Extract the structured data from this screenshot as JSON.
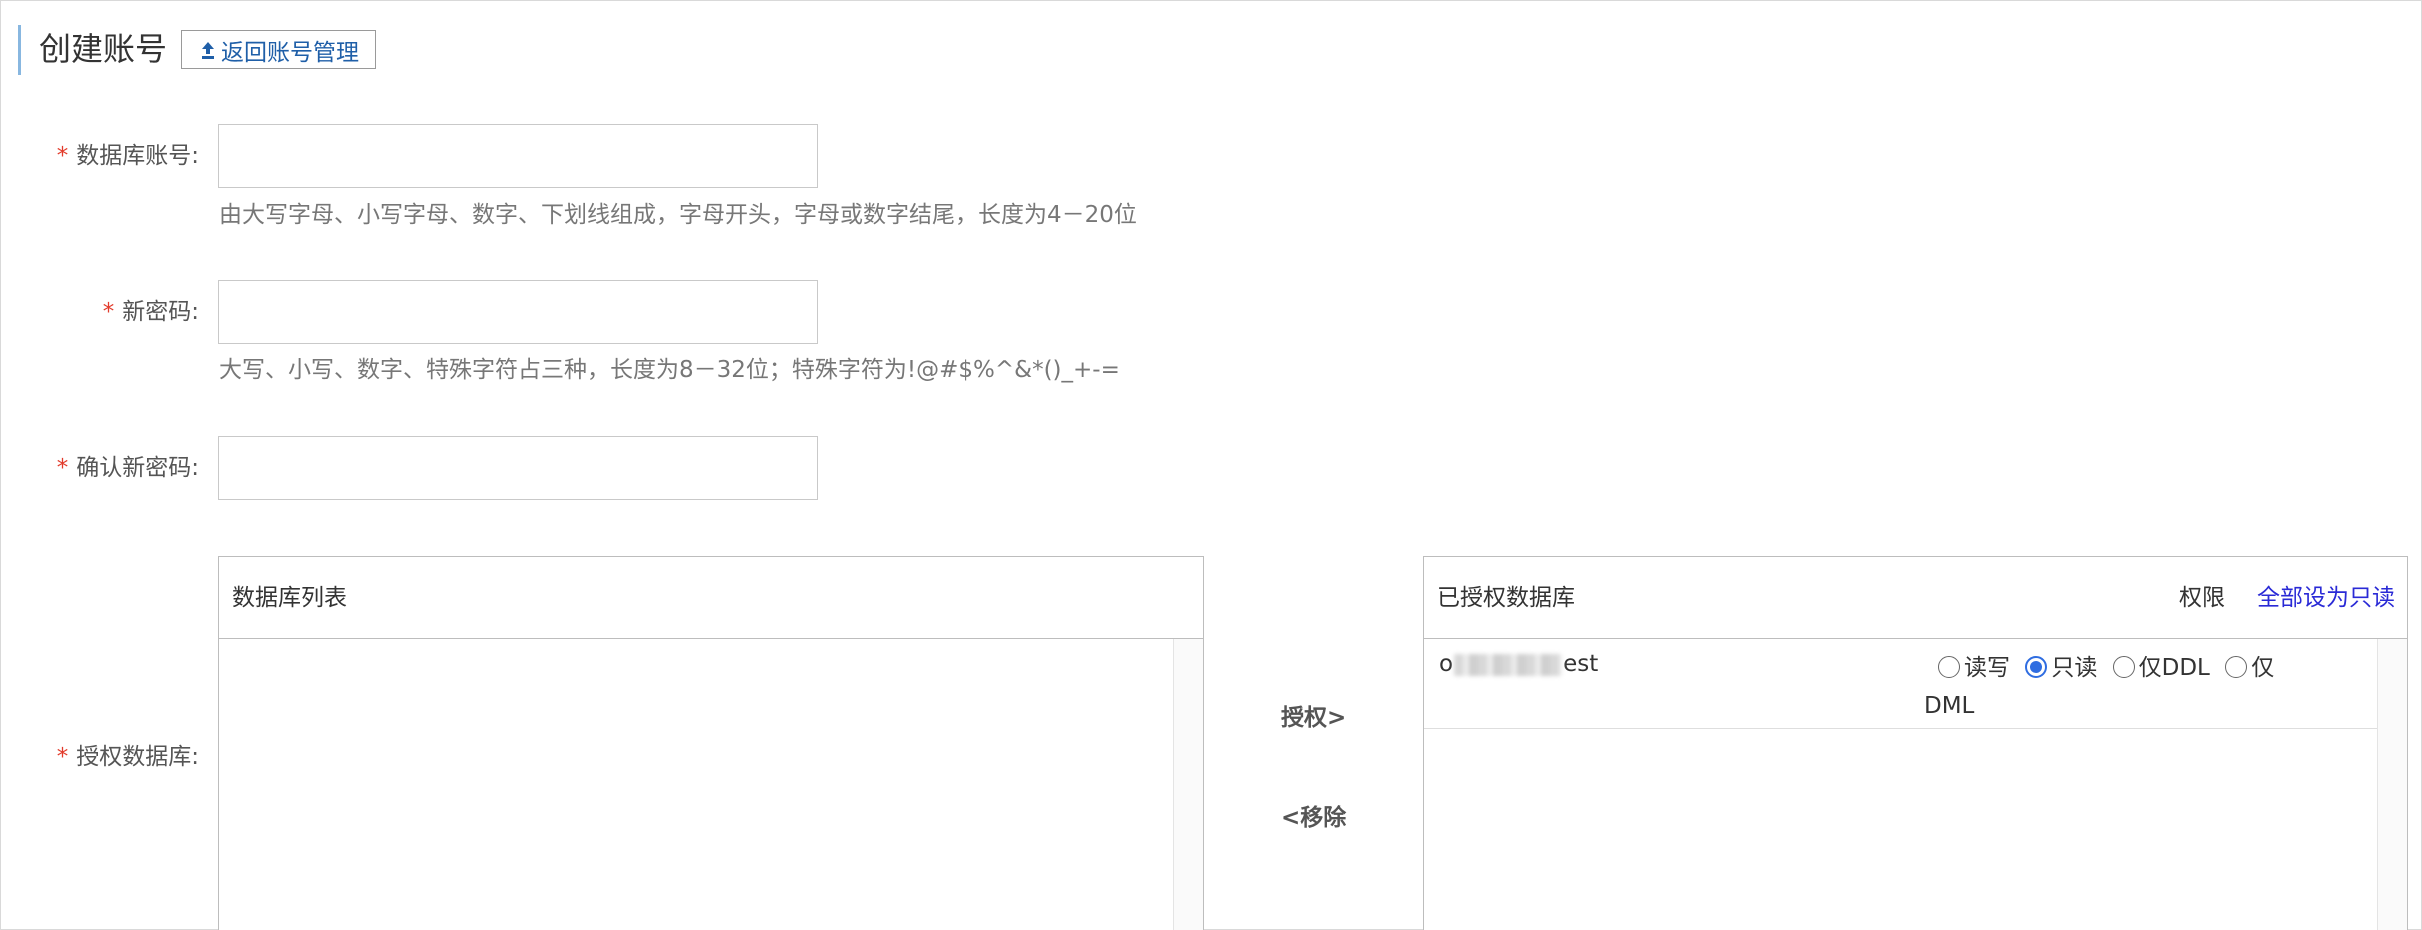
{
  "header": {
    "title": "创建账号",
    "back_label": "返回账号管理"
  },
  "form": {
    "required_mark": "*",
    "account": {
      "label": "数据库账号:",
      "value": "",
      "hint": "由大写字母、小写字母、数字、下划线组成，字母开头，字母或数字结尾，长度为4－20位"
    },
    "password": {
      "label": "新密码:",
      "value": "",
      "hint": "大写、小写、数字、特殊字符占三种，长度为8－32位；特殊字符为!@#$%^&*()_+-="
    },
    "confirm": {
      "label": "确认新密码:",
      "value": ""
    },
    "authorize": {
      "label": "授权数据库:"
    }
  },
  "db_list": {
    "title": "数据库列表"
  },
  "actions": {
    "grant": "授权>",
    "remove": "<移除"
  },
  "authorized": {
    "title": "已授权数据库",
    "perm_label": "权限",
    "set_all_label": "全部设为只读",
    "rows": [
      {
        "name_prefix": "o",
        "name_suffix": "est",
        "options": [
          "读写",
          "只读",
          "仅DDL",
          "仅DML"
        ],
        "selected": "只读"
      }
    ]
  },
  "colors": {
    "accent": "#2f6de1",
    "link": "#2a2ad6",
    "required": "#e23b2b",
    "back_link": "#1f5fa8"
  }
}
